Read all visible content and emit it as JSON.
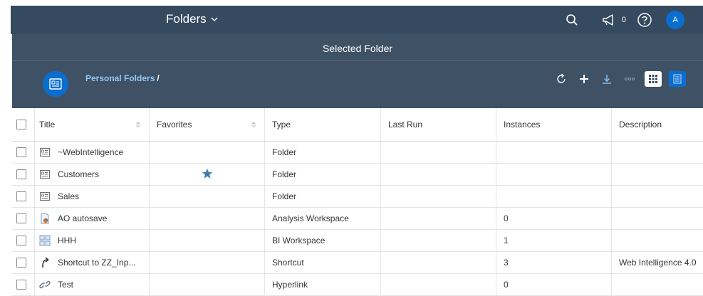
{
  "shell": {
    "title": "Folders",
    "notification_count": "0",
    "avatar_initial": "A",
    "colors": {
      "shell_bg": "#354a5f",
      "accent": "#0a6ed1"
    }
  },
  "header": {
    "title": "Selected Folder",
    "breadcrumb": "Personal Folders",
    "breadcrumb_separator": "/"
  },
  "table": {
    "columns": [
      "Title",
      "Favorites",
      "Type",
      "Last Run",
      "Instances",
      "Description"
    ],
    "rows": [
      {
        "icon": "folder-icon",
        "title": "~WebIntelligence",
        "favorite": false,
        "type": "Folder",
        "last_run": "",
        "instances": "",
        "description": ""
      },
      {
        "icon": "folder-icon",
        "title": "Customers",
        "favorite": true,
        "type": "Folder",
        "last_run": "",
        "instances": "",
        "description": ""
      },
      {
        "icon": "folder-icon",
        "title": "Sales",
        "favorite": false,
        "type": "Folder",
        "last_run": "",
        "instances": "",
        "description": ""
      },
      {
        "icon": "analysis-workspace-icon",
        "title": "AO autosave",
        "favorite": false,
        "type": "Analysis Workspace",
        "last_run": "",
        "instances": "0",
        "description": ""
      },
      {
        "icon": "bi-workspace-icon",
        "title": "HHH",
        "favorite": false,
        "type": "BI Workspace",
        "last_run": "",
        "instances": "1",
        "description": ""
      },
      {
        "icon": "shortcut-icon",
        "title": "Shortcut to ZZ_Inp...",
        "favorite": false,
        "type": "Shortcut",
        "last_run": "",
        "instances": "3",
        "description": "Web Intelligence 4.0"
      },
      {
        "icon": "hyperlink-icon",
        "title": "Test",
        "favorite": false,
        "type": "Hyperlink",
        "last_run": "",
        "instances": "0",
        "description": ""
      }
    ]
  }
}
